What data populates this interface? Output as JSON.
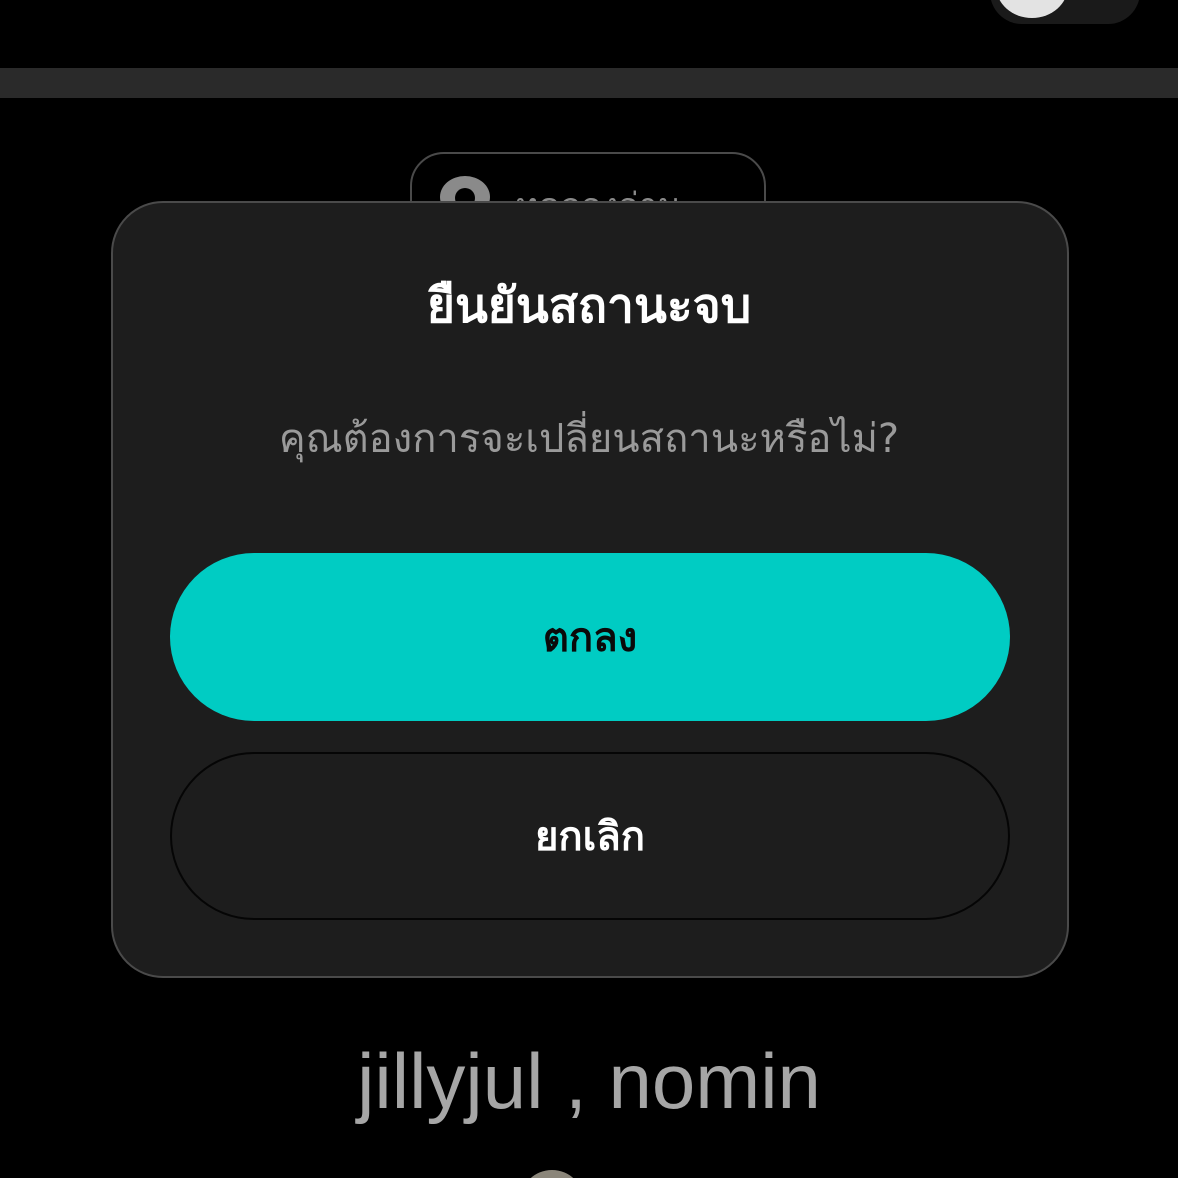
{
  "background_page": {
    "preview_button_label": "ทดลองอ่าน",
    "collaborators_text": "jillyjul , nomin"
  },
  "dialog": {
    "title": "ยืนยันสถานะจบ",
    "message": "คุณต้องการจะเปลี่ยนสถานะหรือไม่?",
    "confirm_label": "ตกลง",
    "cancel_label": "ยกเลิก"
  },
  "colors": {
    "accent": "#00ccc3",
    "dialog_bg": "#1d1d1d",
    "page_bg": "#000000"
  },
  "icons": {
    "preview": "eye-icon"
  }
}
